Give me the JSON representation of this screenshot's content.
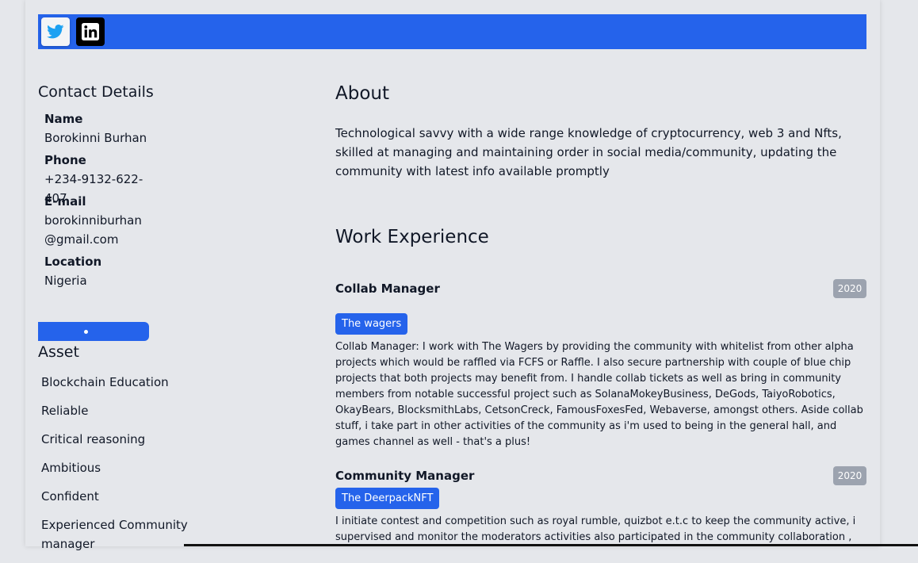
{
  "social": {
    "twitter_icon": "twitter-icon",
    "linkedin_icon": "linkedin-icon"
  },
  "contact": {
    "heading": "Contact Details",
    "name_label": "Name",
    "name_value": "Borokinni Burhan",
    "phone_label": "Phone",
    "phone_value": "+234-9132-622-407",
    "email_label": "E-mail",
    "email_line1": "borokinniburhan",
    "email_line2": "@gmail.com",
    "location_label": "Location",
    "location_value": "Nigeria"
  },
  "asset": {
    "heading": "Asset",
    "items": [
      "Blockchain Education",
      "Reliable",
      "Critical reasoning",
      "Ambitious",
      "Confident",
      "Experienced Community manager"
    ]
  },
  "about": {
    "heading": "About",
    "text": "Technological savvy with a wide range knowledge of cryptocurrency, web 3 and Nfts, skilled at managing and maintaining order in social media/community, updating the community with latest info available promptly"
  },
  "work": {
    "heading": "Work Experience",
    "jobs": [
      {
        "title": "Collab Manager",
        "year": "2020",
        "company": "The wagers",
        "description": "Collab Manager: I work with The Wagers by providing the community with whitelist from other alpha projects which would be raffled via FCFS or Raffle. I also secure partnership with couple of blue chip projects that both projects may benefit from. I handle collab tickets as well as bring in community members from notable successful project such as SolanaMokeyBusiness, DeGods, TaiyoRobotics, OkayBears, BlocksmithLabs, CetsonCreck, FamousFoxesFed, Webaverse, amongst others. Aside collab stuff, i take part in other activities of the community as i'm used to being in the general hall, and games channel as well - that's a plus!"
      },
      {
        "title": "Community Manager",
        "year": "2020",
        "company": "The DeerpackNFT",
        "description": "I initiate contest and competition such as royal rumble, quizbot e.t.c to keep the community active, i supervised and monitor the moderators activities also participated in the community collaboration ,"
      }
    ]
  }
}
